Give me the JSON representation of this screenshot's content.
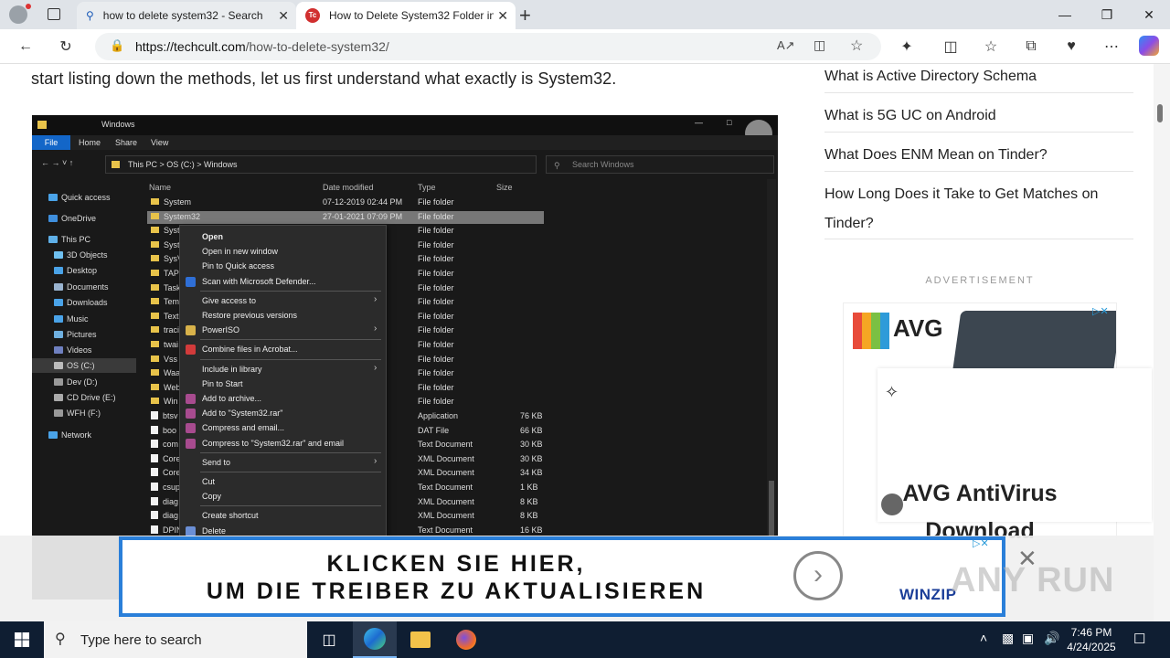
{
  "browser": {
    "tabs": [
      {
        "title": "how to delete system32 - Search",
        "active": false
      },
      {
        "title": "How to Delete System32 Folder in",
        "active": true
      }
    ],
    "url_host": "https://techcult.com",
    "url_path": "/how-to-delete-system32/"
  },
  "article": {
    "intro": "start listing down the methods, let us first understand what exactly is System32."
  },
  "explorer": {
    "window_title": "Windows",
    "ribbon": [
      "File",
      "Home",
      "Share",
      "View"
    ],
    "breadcrumb": "This PC  >  OS (C:)  >  Windows",
    "search_placeholder": "Search Windows",
    "nav": [
      "Quick access",
      "OneDrive",
      "This PC",
      "3D Objects",
      "Desktop",
      "Documents",
      "Downloads",
      "Music",
      "Pictures",
      "Videos",
      "OS (C:)",
      "Dev (D:)",
      "CD Drive (E:)",
      "WFH (F:)",
      "Network"
    ],
    "columns": [
      "Name",
      "Date modified",
      "Type",
      "Size"
    ],
    "rows": [
      {
        "name": "System",
        "date": "07-12-2019 02:44 PM",
        "type": "File folder",
        "size": "",
        "folder": true
      },
      {
        "name": "System32",
        "date": "27-01-2021 07:09 PM",
        "type": "File folder",
        "size": "",
        "folder": true
      },
      {
        "name": "Syst",
        "date": "PM",
        "type": "File folder",
        "size": "",
        "folder": true
      },
      {
        "name": "Syst",
        "date": "PM",
        "type": "File folder",
        "size": "",
        "folder": true
      },
      {
        "name": "SysV",
        "date": "PM",
        "type": "File folder",
        "size": "",
        "folder": true
      },
      {
        "name": "TAPI",
        "date": "PM",
        "type": "File folder",
        "size": "",
        "folder": true
      },
      {
        "name": "Task",
        "date": "PM",
        "type": "File folder",
        "size": "",
        "folder": true
      },
      {
        "name": "Tem",
        "date": "PM",
        "type": "File folder",
        "size": "",
        "folder": true
      },
      {
        "name": "Text",
        "date": "AM",
        "type": "File folder",
        "size": "",
        "folder": true
      },
      {
        "name": "traci",
        "date": "PM",
        "type": "File folder",
        "size": "",
        "folder": true
      },
      {
        "name": "twai",
        "date": "PM",
        "type": "File folder",
        "size": "",
        "folder": true
      },
      {
        "name": "Vss",
        "date": "PM",
        "type": "File folder",
        "size": "",
        "folder": true
      },
      {
        "name": "Waa",
        "date": "PM",
        "type": "File folder",
        "size": "",
        "folder": true
      },
      {
        "name": "Web",
        "date": "PM",
        "type": "File folder",
        "size": "",
        "folder": true
      },
      {
        "name": "Win",
        "date": "PM",
        "type": "File folder",
        "size": "",
        "folder": true
      },
      {
        "name": "btsv",
        "date": "AM",
        "type": "Application",
        "size": "76 KB",
        "folder": false
      },
      {
        "name": "boo",
        "date": "PM",
        "type": "DAT File",
        "size": "66 KB",
        "folder": false
      },
      {
        "name": "com",
        "date": "PM",
        "type": "Text Document",
        "size": "30 KB",
        "folder": false
      },
      {
        "name": "Core",
        "date": "PM",
        "type": "XML Document",
        "size": "30 KB",
        "folder": false
      },
      {
        "name": "Core",
        "date": "AM",
        "type": "XML Document",
        "size": "34 KB",
        "folder": false
      },
      {
        "name": "csup",
        "date": "AM",
        "type": "Text Document",
        "size": "1 KB",
        "folder": false
      },
      {
        "name": "diag",
        "date": "PM",
        "type": "XML Document",
        "size": "8 KB",
        "folder": false
      },
      {
        "name": "diag",
        "date": "PM",
        "type": "XML Document",
        "size": "8 KB",
        "folder": false
      },
      {
        "name": "DPIN",
        "date": "PM",
        "type": "Text Document",
        "size": "16 KB",
        "folder": false
      }
    ],
    "context_menu": [
      {
        "label": "Open",
        "bold": true
      },
      {
        "label": "Open in new window"
      },
      {
        "label": "Pin to Quick access"
      },
      {
        "label": "Scan with Microsoft Defender...",
        "icon": "#2f6fd6"
      },
      {
        "sep": true
      },
      {
        "label": "Give access to",
        "sub": true
      },
      {
        "label": "Restore previous versions"
      },
      {
        "label": "PowerISO",
        "sub": true,
        "icon": "#d8b24a"
      },
      {
        "sep": true
      },
      {
        "label": "Combine files in Acrobat...",
        "icon": "#d23b3b"
      },
      {
        "sep": true
      },
      {
        "label": "Include in library",
        "sub": true
      },
      {
        "label": "Pin to Start"
      },
      {
        "label": "Add to archive...",
        "icon": "#a84b8f"
      },
      {
        "label": "Add to \"System32.rar\"",
        "icon": "#a84b8f"
      },
      {
        "label": "Compress and email...",
        "icon": "#a84b8f"
      },
      {
        "label": "Compress to \"System32.rar\" and email",
        "icon": "#a84b8f"
      },
      {
        "sep": true
      },
      {
        "label": "Send to",
        "sub": true
      },
      {
        "sep": true
      },
      {
        "label": "Cut"
      },
      {
        "label": "Copy"
      },
      {
        "sep": true
      },
      {
        "label": "Create shortcut"
      },
      {
        "label": "Delete",
        "icon": "#6b8fd6"
      }
    ]
  },
  "sidebar": {
    "links": [
      "What is Active Directory Schema",
      "What is 5G UC on Android",
      "What Does ENM Mean on Tinder?",
      "How Long Does it Take to Get Matches on",
      "Tinder?"
    ],
    "ad_label": "ADVERTISEMENT",
    "ad_brand": "AVG",
    "ad_title": "AVG AntiVirus Download"
  },
  "banner_ad": {
    "line1": "KLICKEN SIE HIER,",
    "line2": "UM DIE TREIBER ZU AKTUALISIEREN",
    "brand": "WINZIP",
    "watermark": "ANY RUN"
  },
  "taskbar": {
    "search_placeholder": "Type here to search",
    "time": "7:46 PM",
    "date": "4/24/2025"
  },
  "colors": {
    "accent": "#2a7fd9",
    "taskbar": "#0f1e32",
    "explorer_bg": "#191919"
  }
}
